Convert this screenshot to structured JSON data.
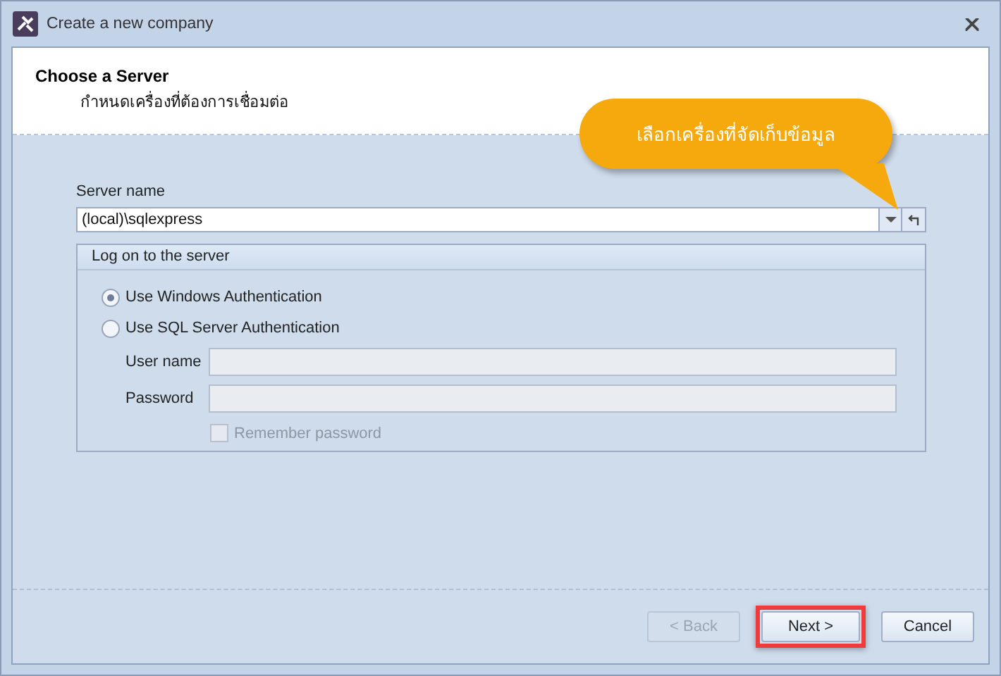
{
  "window": {
    "title": "Create a new company"
  },
  "header": {
    "title": "Choose a Server",
    "subtitle": "กำหนดเครื่องที่ต้องการเชื่อมต่อ"
  },
  "callout": {
    "text": "เลือกเครื่องที่จัดเก็บข้อมูล"
  },
  "server_name": {
    "label": "Server name",
    "value": "(local)\\sqlexpress"
  },
  "logon": {
    "title": "Log on to the server",
    "options": [
      {
        "label": "Use Windows Authentication",
        "selected": true
      },
      {
        "label": "Use SQL Server Authentication",
        "selected": false
      }
    ],
    "fields": [
      {
        "label": "User name",
        "disabled": true
      },
      {
        "label": "Password",
        "disabled": true
      }
    ],
    "remember": {
      "label": "Remember password",
      "checked": false,
      "disabled": true
    }
  },
  "buttons": [
    {
      "label": "< Back",
      "disabled": true,
      "highlighted": false
    },
    {
      "label": "Next >",
      "disabled": false,
      "highlighted": true
    },
    {
      "label": "Cancel",
      "disabled": false,
      "highlighted": false
    }
  ]
}
